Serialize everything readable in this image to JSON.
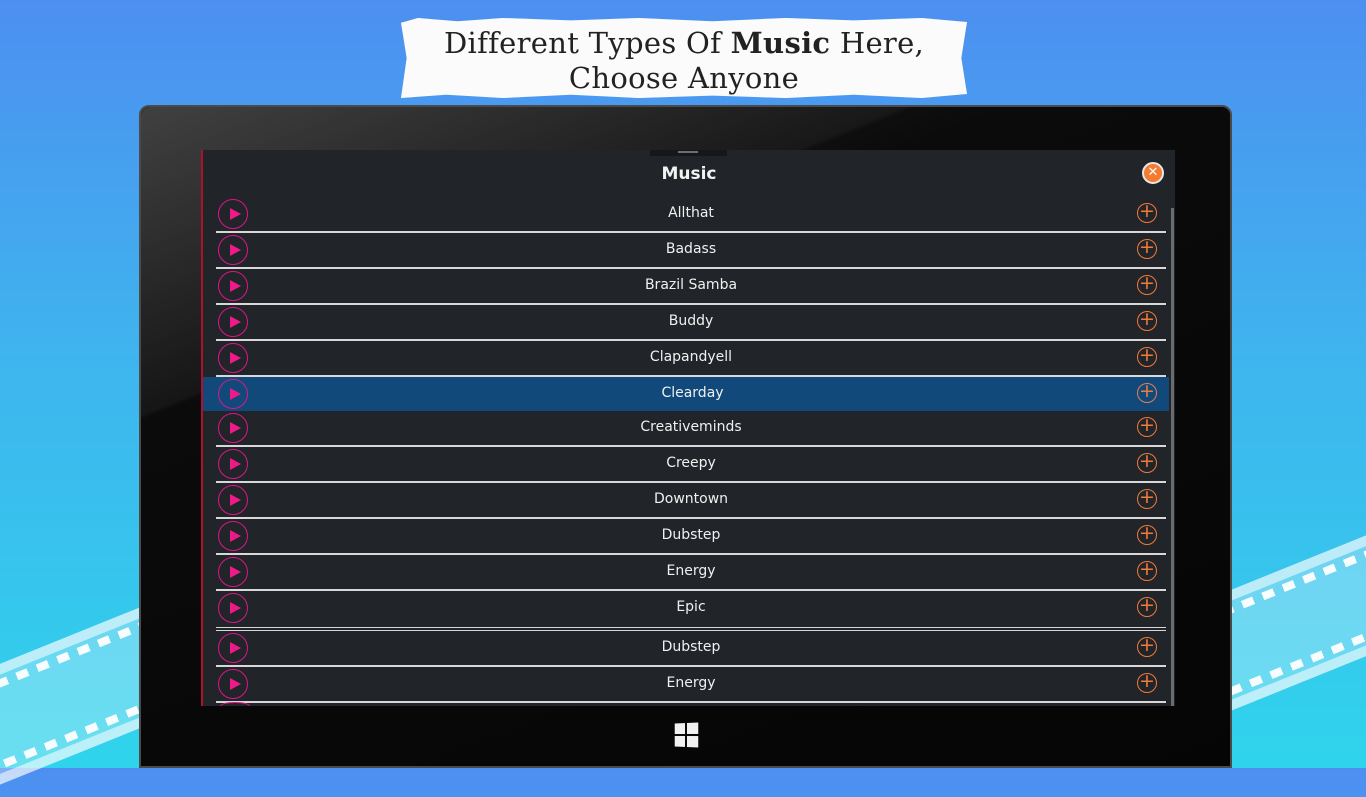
{
  "banner": {
    "line1_pre": "Different Types Of ",
    "line1_bold": "Music",
    "line1_post": " Here,",
    "line2": "Choose Anyone"
  },
  "dialog": {
    "title": "Music",
    "close_icon": "close-circle-icon"
  },
  "colors": {
    "panel_bg": "#212428",
    "selected_row": "#114a7a",
    "play_accent": "#ee1a8a",
    "add_accent": "#f07a3a",
    "close_bg": "#f57b30"
  },
  "tracks": [
    {
      "name": "Allthat"
    },
    {
      "name": "Badass"
    },
    {
      "name": "Brazil Samba"
    },
    {
      "name": "Buddy"
    },
    {
      "name": "Clapandyell"
    },
    {
      "name": "Clearday",
      "selected": true
    },
    {
      "name": "Creativeminds"
    },
    {
      "name": "Creepy"
    },
    {
      "name": "Downtown"
    },
    {
      "name": "Dubstep"
    },
    {
      "name": "Energy"
    },
    {
      "name": "Epic"
    },
    {
      "name": "Dubstep"
    },
    {
      "name": "Energy"
    }
  ],
  "icons": {
    "play": "play-circle-icon",
    "add": "add-circle-icon",
    "windows": "windows-logo-icon"
  }
}
